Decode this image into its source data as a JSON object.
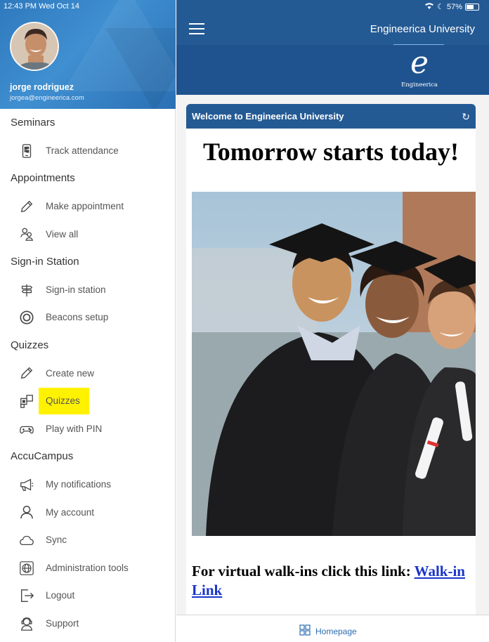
{
  "status": {
    "time_date": "12:43 PM   Wed Oct 14",
    "battery": "57%"
  },
  "user": {
    "name": "jorge rodriguez",
    "email": "jorgea@engineerica.com"
  },
  "menu": {
    "seminars": {
      "title": "Seminars",
      "items": [
        {
          "label": "Track attendance",
          "icon": "qr-phone-icon"
        }
      ]
    },
    "appointments": {
      "title": "Appointments",
      "items": [
        {
          "label": "Make appointment",
          "icon": "pencil-icon"
        },
        {
          "label": "View all",
          "icon": "people-icon"
        }
      ]
    },
    "signin": {
      "title": "Sign-in Station",
      "items": [
        {
          "label": "Sign-in station",
          "icon": "signpost-icon"
        },
        {
          "label": "Beacons setup",
          "icon": "target-icon"
        }
      ]
    },
    "quizzes": {
      "title": "Quizzes",
      "items": [
        {
          "label": "Create new",
          "icon": "pencil-icon"
        },
        {
          "label": "Quizzes",
          "icon": "puzzle-icon",
          "highlighted": true
        },
        {
          "label": "Play with PIN",
          "icon": "gamepad-icon"
        }
      ]
    },
    "accucampus": {
      "title": "AccuCampus",
      "items": [
        {
          "label": "My notifications",
          "icon": "megaphone-icon"
        },
        {
          "label": "My account",
          "icon": "user-icon"
        },
        {
          "label": "Sync",
          "icon": "cloud-icon"
        },
        {
          "label": "Administration tools",
          "icon": "globe-icon"
        },
        {
          "label": "Logout",
          "icon": "logout-icon"
        },
        {
          "label": "Support",
          "icon": "support-icon"
        }
      ]
    }
  },
  "header": {
    "title": "Engineerica University",
    "logo_text": "Engineerica"
  },
  "card": {
    "title": "Welcome to Engineerica University",
    "headline": "Tomorrow starts today!",
    "walkin_text": "For virtual walk-ins click this link: ",
    "walkin_link": "Walk-in Link"
  },
  "bottom": {
    "home_label": "Homepage"
  },
  "colors": {
    "header_blue": "#245a94",
    "highlight": "#fff200",
    "link": "#1a35c9"
  }
}
